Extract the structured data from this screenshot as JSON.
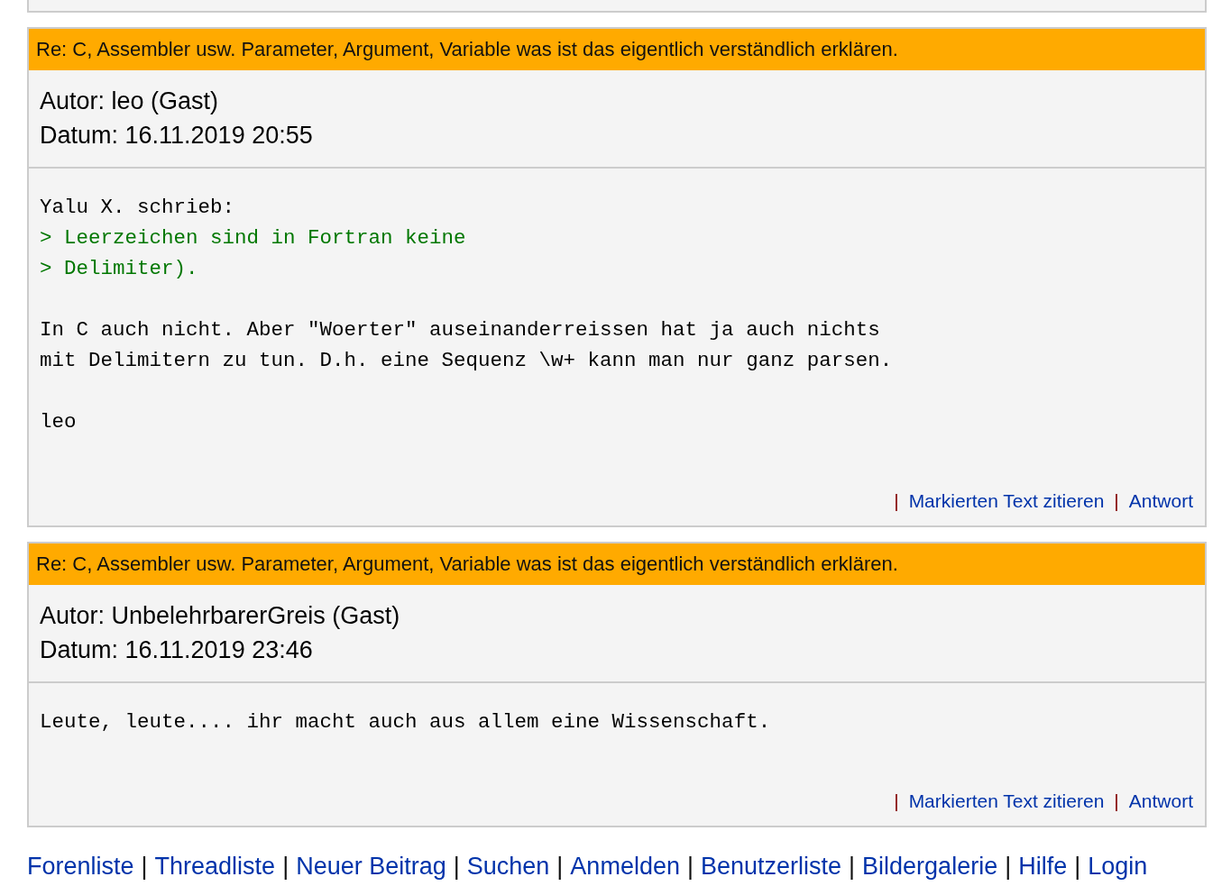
{
  "posts": [
    {
      "title": "Re: C, Assembler usw. Parameter, Argument, Variable was ist das eigentlich verständlich erklären.",
      "author": "Autor: leo (Gast)",
      "date": "Datum: 16.11.2019 20:55",
      "paragraphs": [
        {
          "lines": [
            {
              "kind": "plain",
              "text": "Yalu X. schrieb:"
            },
            {
              "kind": "quote",
              "text": "> Leerzeichen sind in Fortran keine"
            },
            {
              "kind": "quote",
              "text": "> Delimiter)."
            }
          ]
        },
        {
          "lines": [
            {
              "kind": "plain",
              "text": "In C auch nicht. Aber \"Woerter\" auseinanderreissen hat ja auch nichts"
            },
            {
              "kind": "plain",
              "text": "mit Delimitern zu tun. D.h. eine Sequenz \\w+ kann man nur ganz parsen."
            }
          ]
        },
        {
          "lines": [
            {
              "kind": "plain",
              "text": "leo"
            }
          ]
        }
      ],
      "actions": [
        {
          "separator": "|",
          "label": "Markierten Text zitieren"
        },
        {
          "separator": "|",
          "label": "Antwort"
        }
      ]
    },
    {
      "title": "Re: C, Assembler usw. Parameter, Argument, Variable was ist das eigentlich verständlich erklären.",
      "author": "Autor: UnbelehrbarerGreis (Gast)",
      "date": "Datum: 16.11.2019 23:46",
      "paragraphs": [
        {
          "lines": [
            {
              "kind": "plain",
              "text": "Leute, leute.... ihr macht auch aus allem eine Wissenschaft."
            }
          ]
        }
      ],
      "actions": [
        {
          "separator": "|",
          "label": "Markierten Text zitieren"
        },
        {
          "separator": "|",
          "label": "Antwort"
        }
      ]
    }
  ],
  "nav": [
    {
      "label": "Forenliste"
    },
    {
      "separator": "|",
      "label": "Threadliste"
    },
    {
      "separator": "|",
      "label": "Neuer Beitrag"
    },
    {
      "separator": "|",
      "label": "Suchen"
    },
    {
      "separator": "|",
      "label": "Anmelden"
    },
    {
      "separator": "|",
      "label": "Benutzerliste"
    },
    {
      "separator": "|",
      "label": "Bildergalerie"
    },
    {
      "separator": "|",
      "label": "Hilfe"
    },
    {
      "separator": "|",
      "label": "Login"
    }
  ]
}
